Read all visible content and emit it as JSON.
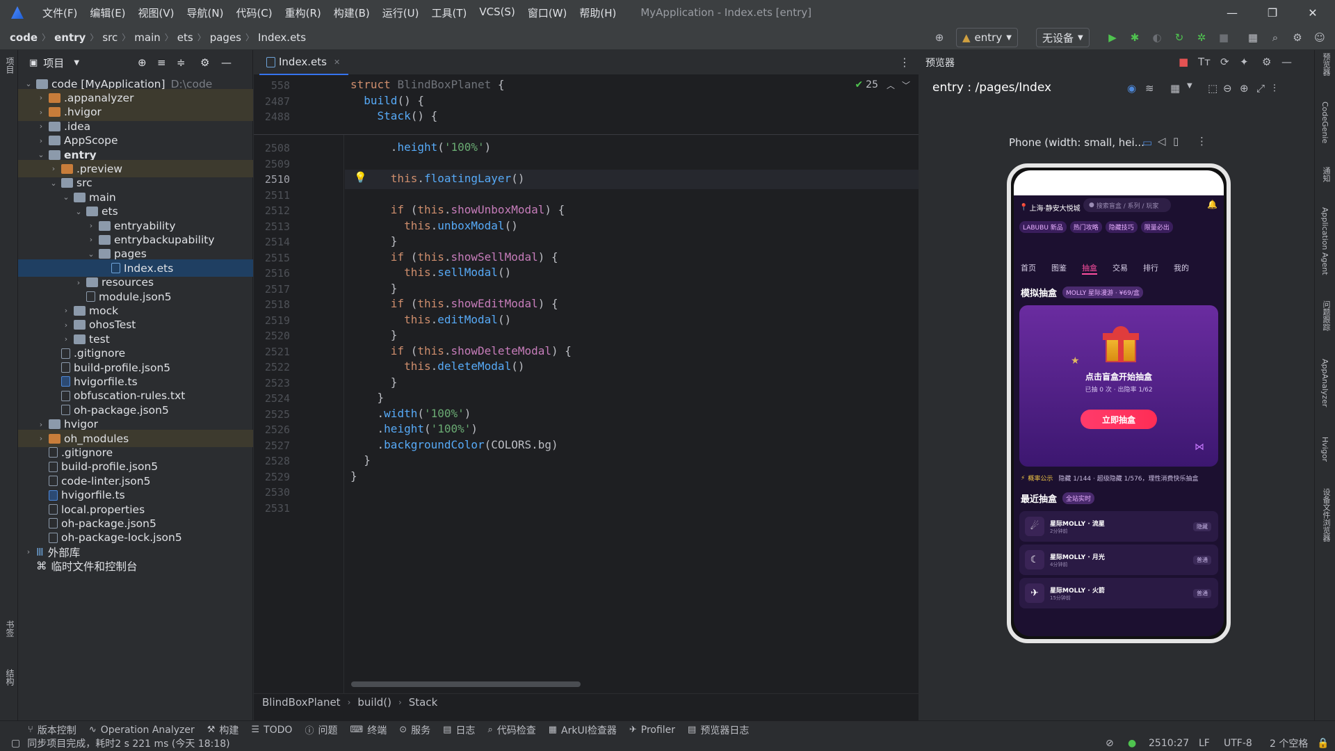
{
  "menubar": {
    "items": [
      "文件(F)",
      "编辑(E)",
      "视图(V)",
      "导航(N)",
      "代码(C)",
      "重构(R)",
      "构建(B)",
      "运行(U)",
      "工具(T)",
      "VCS(S)",
      "窗口(W)",
      "帮助(H)"
    ],
    "title": "MyApplication - Index.ets [entry]"
  },
  "breadcrumb": [
    "code",
    "entry",
    "src",
    "main",
    "ets",
    "pages",
    "Index.ets"
  ],
  "run_config": {
    "label": "entry",
    "device": "无设备"
  },
  "project_panel": {
    "title": "项目",
    "tree": [
      {
        "label": "code [MyApplication]",
        "extra": "D:\\code",
        "depth": 0,
        "type": "folder",
        "open": true
      },
      {
        "label": ".appanalyzer",
        "depth": 1,
        "type": "folder-orange",
        "hl": true
      },
      {
        "label": ".hvigor",
        "depth": 1,
        "type": "folder-orange",
        "hl": true
      },
      {
        "label": ".idea",
        "depth": 1,
        "type": "folder"
      },
      {
        "label": "AppScope",
        "depth": 1,
        "type": "folder"
      },
      {
        "label": "entry",
        "depth": 1,
        "type": "folder",
        "open": true,
        "bold": true
      },
      {
        "label": ".preview",
        "depth": 2,
        "type": "folder-orange",
        "hl": true
      },
      {
        "label": "src",
        "depth": 2,
        "type": "folder",
        "open": true
      },
      {
        "label": "main",
        "depth": 3,
        "type": "folder",
        "open": true
      },
      {
        "label": "ets",
        "depth": 4,
        "type": "folder",
        "open": true
      },
      {
        "label": "entryability",
        "depth": 5,
        "type": "folder"
      },
      {
        "label": "entrybackupability",
        "depth": 5,
        "type": "folder"
      },
      {
        "label": "pages",
        "depth": 5,
        "type": "folder",
        "open": true
      },
      {
        "label": "Index.ets",
        "depth": 6,
        "type": "file-ets",
        "sel": true
      },
      {
        "label": "resources",
        "depth": 4,
        "type": "folder"
      },
      {
        "label": "module.json5",
        "depth": 4,
        "type": "file"
      },
      {
        "label": "mock",
        "depth": 3,
        "type": "folder"
      },
      {
        "label": "ohosTest",
        "depth": 3,
        "type": "folder"
      },
      {
        "label": "test",
        "depth": 3,
        "type": "folder"
      },
      {
        "label": ".gitignore",
        "depth": 2,
        "type": "file"
      },
      {
        "label": "build-profile.json5",
        "depth": 2,
        "type": "file"
      },
      {
        "label": "hvigorfile.ts",
        "depth": 2,
        "type": "file-blue"
      },
      {
        "label": "obfuscation-rules.txt",
        "depth": 2,
        "type": "file"
      },
      {
        "label": "oh-package.json5",
        "depth": 2,
        "type": "file"
      },
      {
        "label": "hvigor",
        "depth": 1,
        "type": "folder"
      },
      {
        "label": "oh_modules",
        "depth": 1,
        "type": "folder-orange",
        "hl": true
      },
      {
        "label": ".gitignore",
        "depth": 1,
        "type": "file"
      },
      {
        "label": "build-profile.json5",
        "depth": 1,
        "type": "file"
      },
      {
        "label": "code-linter.json5",
        "depth": 1,
        "type": "file"
      },
      {
        "label": "hvigorfile.ts",
        "depth": 1,
        "type": "file-blue"
      },
      {
        "label": "local.properties",
        "depth": 1,
        "type": "file"
      },
      {
        "label": "oh-package.json5",
        "depth": 1,
        "type": "file"
      },
      {
        "label": "oh-package-lock.json5",
        "depth": 1,
        "type": "file"
      },
      {
        "label": "外部库",
        "depth": 0,
        "type": "lib"
      },
      {
        "label": "临时文件和控制台",
        "depth": 0,
        "type": "scratch"
      }
    ]
  },
  "editor": {
    "tab": "Index.ets",
    "check_count": "25",
    "sticky": [
      {
        "no": "558",
        "html": "<span class=\"kw\">struct</span> <span class=\"cls\">BlindBoxPlanet</span> {"
      },
      {
        "no": "2487",
        "html": "  <span class=\"fn\">build</span>() {"
      },
      {
        "no": "2488",
        "html": "    <span class=\"fn\">Stack</span>() {"
      }
    ],
    "lines": [
      {
        "no": "2508",
        "html": "      .<span class=\"fn\">height</span>(<span class=\"str\">'100%'</span>)"
      },
      {
        "no": "2509",
        "html": ""
      },
      {
        "no": "2510",
        "html": "      <span class=\"kw\">this</span>.<span class=\"fn\">floatingLayer</span>()",
        "active": true
      },
      {
        "no": "2511",
        "html": ""
      },
      {
        "no": "2512",
        "html": "      <span class=\"kw\">if</span> (<span class=\"kw\">this</span>.<span class=\"prop\">showUnboxModal</span>) {"
      },
      {
        "no": "2513",
        "html": "        <span class=\"kw\">this</span>.<span class=\"fn\">unboxModal</span>()"
      },
      {
        "no": "2514",
        "html": "      }"
      },
      {
        "no": "2515",
        "html": "      <span class=\"kw\">if</span> (<span class=\"kw\">this</span>.<span class=\"prop\">showSellModal</span>) {"
      },
      {
        "no": "2516",
        "html": "        <span class=\"kw\">this</span>.<span class=\"fn\">sellModal</span>()"
      },
      {
        "no": "2517",
        "html": "      }"
      },
      {
        "no": "2518",
        "html": "      <span class=\"kw\">if</span> (<span class=\"kw\">this</span>.<span class=\"prop\">showEditModal</span>) {"
      },
      {
        "no": "2519",
        "html": "        <span class=\"kw\">this</span>.<span class=\"fn\">editModal</span>()"
      },
      {
        "no": "2520",
        "html": "      }"
      },
      {
        "no": "2521",
        "html": "      <span class=\"kw\">if</span> (<span class=\"kw\">this</span>.<span class=\"prop\">showDeleteModal</span>) {"
      },
      {
        "no": "2522",
        "html": "        <span class=\"kw\">this</span>.<span class=\"fn\">deleteModal</span>()"
      },
      {
        "no": "2523",
        "html": "      }"
      },
      {
        "no": "2524",
        "html": "    }"
      },
      {
        "no": "2525",
        "html": "    .<span class=\"fn\">width</span>(<span class=\"str\">'100%'</span>)"
      },
      {
        "no": "2526",
        "html": "    .<span class=\"fn\">height</span>(<span class=\"str\">'100%'</span>)"
      },
      {
        "no": "2527",
        "html": "    .<span class=\"fn\">backgroundColor</span>(COLORS.bg)"
      },
      {
        "no": "2528",
        "html": "  }"
      },
      {
        "no": "2529",
        "html": "}"
      },
      {
        "no": "2530",
        "html": ""
      },
      {
        "no": "2531",
        "html": ""
      }
    ],
    "breadcrumb": [
      "BlindBoxPlanet",
      "build()",
      "Stack"
    ]
  },
  "preview": {
    "title": "预览器",
    "route": "entry : /pages/Index",
    "device_label": "Phone (width: small, hei...",
    "app": {
      "location": "上海·静安大悦城",
      "search_placeholder": "搜索盲盒 / 系列 / 玩家",
      "pills": [
        "LABUBU 新品",
        "热门攻略",
        "隐藏技巧",
        "限量必出"
      ],
      "nav": [
        "首页",
        "图鉴",
        "抽盒",
        "交易",
        "排行",
        "我的"
      ],
      "nav_active": "抽盒",
      "section_title": "模拟抽盒",
      "section_pill": "MOLLY 星际漫游 · ¥69/盒",
      "hero_title": "点击盲盒开始抽盒",
      "hero_sub": "已抽 0 次 · 出隐率 1/62",
      "cta": "立即抽盒",
      "notice_label": "概率公示",
      "notice": "隐藏 1/144 · 超级隐藏 1/576，理性消费快乐抽盒",
      "recent_title": "最近抽盒",
      "recent_pill": "全站实时",
      "recent": [
        {
          "name": "星际MOLLY · 流星",
          "time": "2分钟前",
          "tag": "隐藏"
        },
        {
          "name": "星际MOLLY · 月光",
          "time": "4分钟前",
          "tag": "普通"
        },
        {
          "name": "星际MOLLY · 火箭",
          "time": "15分钟前",
          "tag": "普通"
        }
      ]
    }
  },
  "left_strip": {
    "top": "项目",
    "bookmarks": "书签",
    "structure": "结构"
  },
  "right_strip": [
    "预览器",
    "CodeGenie",
    "通知",
    "Application Agent",
    "问题跟踪",
    "AppAnalyzer",
    "Hvigor",
    "设备文件浏览器"
  ],
  "bottom_tools": [
    "版本控制",
    "Operation Analyzer",
    "构建",
    "TODO",
    "问题",
    "终端",
    "服务",
    "日志",
    "代码检查",
    "ArkUI检查器",
    "Profiler",
    "预览器日志"
  ],
  "status": {
    "message": "同步项目完成，耗时2 s 221 ms (今天 18:18)",
    "position": "2510:27",
    "line_sep": "LF",
    "encoding": "UTF-8",
    "indent": "2 个空格"
  }
}
